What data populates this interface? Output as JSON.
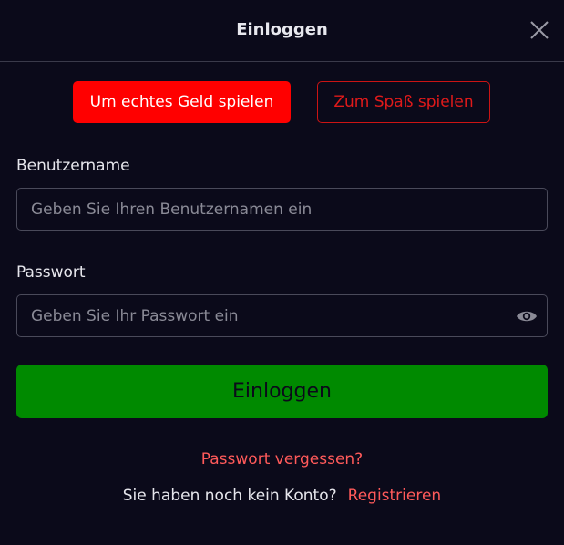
{
  "header": {
    "title": "Einloggen",
    "close_icon": "close-icon"
  },
  "mode": {
    "real_money_label": "Um echtes Geld spielen",
    "for_fun_label": "Zum Spaß spielen"
  },
  "form": {
    "username_label": "Benutzername",
    "username_placeholder": "Geben Sie Ihren Benutzernamen ein",
    "username_value": "",
    "password_label": "Passwort",
    "password_placeholder": "Geben Sie Ihr Passwort ein",
    "password_value": "",
    "show_password_icon": "eye-icon",
    "submit_label": "Einloggen"
  },
  "footer": {
    "forgot_password": "Passwort vergessen?",
    "no_account_text": "Sie haben noch kein Konto?",
    "register_link": "Registrieren"
  },
  "colors": {
    "background": "#0b0a1a",
    "accent_red": "#ff0000",
    "link_red": "#ff5a5a",
    "submit_green": "#008a00"
  }
}
